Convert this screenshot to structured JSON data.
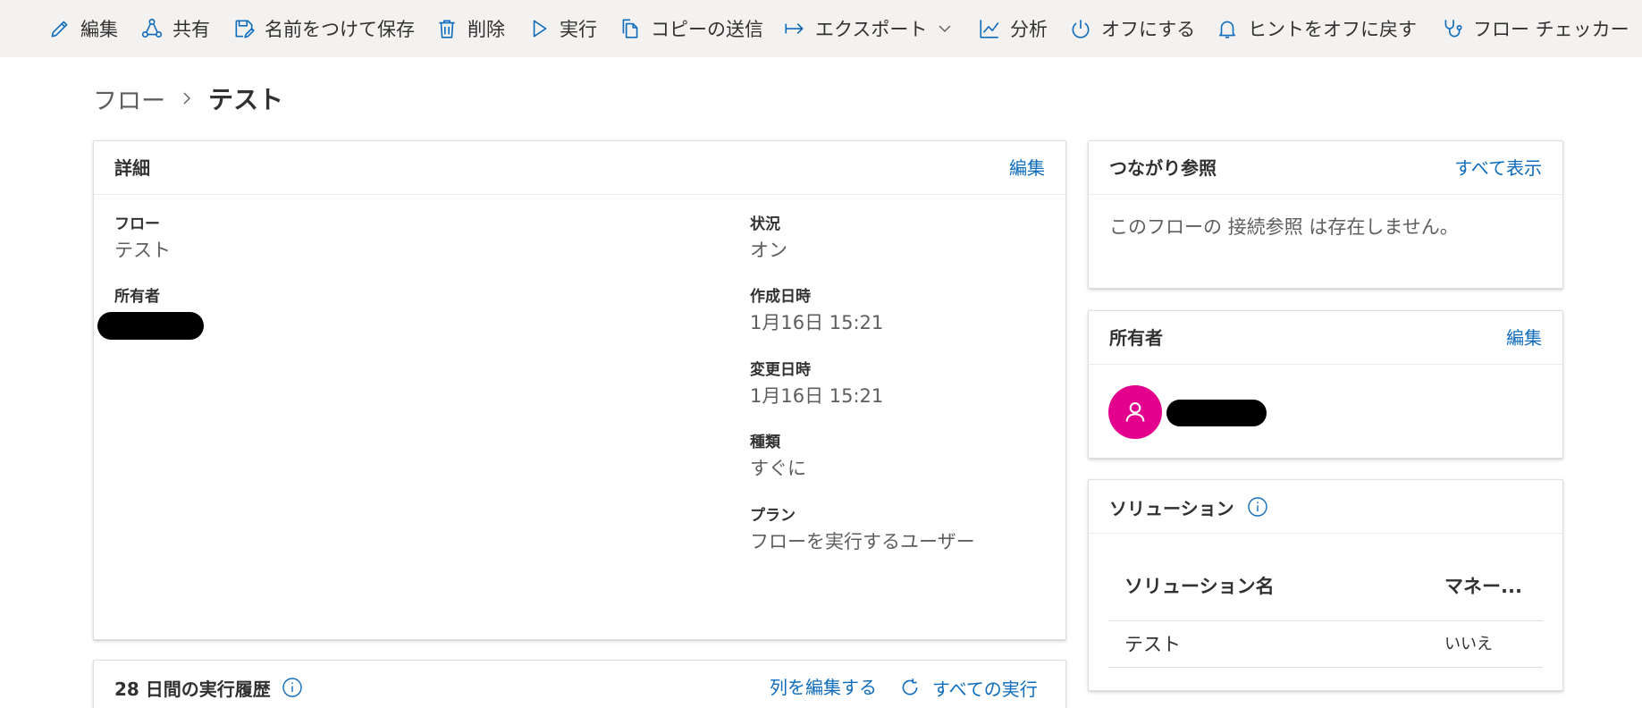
{
  "colors": {
    "accent": "#0f6cbd",
    "avatar_bg": "#e3008c",
    "command_bar_bg": "#f3f2f1"
  },
  "toolbar": {
    "edit": "編集",
    "share": "共有",
    "save_as": "名前をつけて保存",
    "delete": "削除",
    "run": "実行",
    "send_copy": "コピーの送信",
    "export": "エクスポート",
    "analytics": "分析",
    "turn_off": "オフにする",
    "hints_off": "ヒントをオフに戻す",
    "flow_checker": "フロー チェッカー"
  },
  "breadcrumb": {
    "parent": "フロー",
    "current": "テスト"
  },
  "details": {
    "title": "詳細",
    "edit_link": "編集",
    "flow_label": "フロー",
    "flow_value": "テスト",
    "owner_label": "所有者",
    "status_label": "状況",
    "status_value": "オン",
    "created_label": "作成日時",
    "created_value": "1月16日 15:21",
    "modified_label": "変更日時",
    "modified_value": "1月16日 15:21",
    "type_label": "種類",
    "type_value": "すぐに",
    "plan_label": "プラン",
    "plan_value": "フローを実行するユーザー"
  },
  "history": {
    "title": "28 日間の実行履歴",
    "edit_columns": "列を編集する",
    "all_runs": "すべての実行"
  },
  "connection_refs": {
    "title": "つながり参照",
    "see_all": "すべて表示",
    "empty_text": "このフローの 接続参照 は存在しません。"
  },
  "owners": {
    "title": "所有者",
    "edit_link": "編集"
  },
  "solutions": {
    "title": "ソリューション",
    "col_name": "ソリューション名",
    "col_managed": "マネー...",
    "rows": [
      {
        "name": "テスト",
        "managed": "いいえ"
      }
    ]
  }
}
